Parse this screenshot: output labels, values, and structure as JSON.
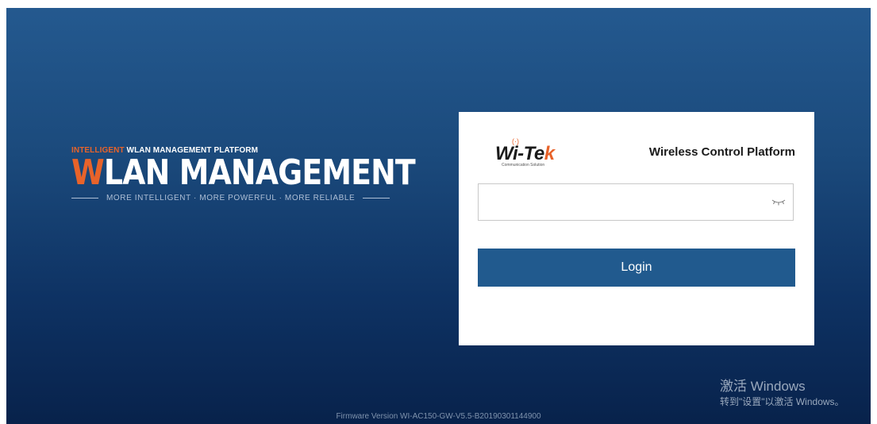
{
  "hero": {
    "tag_accent": "INTELLIGENT",
    "tag_rest": " WLAN MANAGEMENT PLATFORM",
    "title_accent": "W",
    "title_rest": "LAN MANAGEMENT",
    "subtitle": "MORE INTELLIGENT · MORE POWERFUL · MORE RELIABLE"
  },
  "login_card": {
    "logo_wifi": "(·)",
    "logo_main": "Wi-Te",
    "logo_main_accent": "k",
    "logo_sub": "Communication Solution",
    "title": "Wireless Control Platform",
    "password_value": "",
    "login_label": "Login"
  },
  "windows_notice": {
    "title": "激活 Windows",
    "subtitle": "转到\"设置\"以激活 Windows。"
  },
  "footer": {
    "firmware": "Firmware Version WI-AC150-GW-V5.5-B20190301144900"
  },
  "colors": {
    "accent": "#e8632a",
    "button": "#215a8e",
    "background_top": "#24598f",
    "background_bottom": "#08224b"
  },
  "icons": {
    "eye": "eye-closed-icon",
    "wifi": "wifi-signal-icon"
  }
}
